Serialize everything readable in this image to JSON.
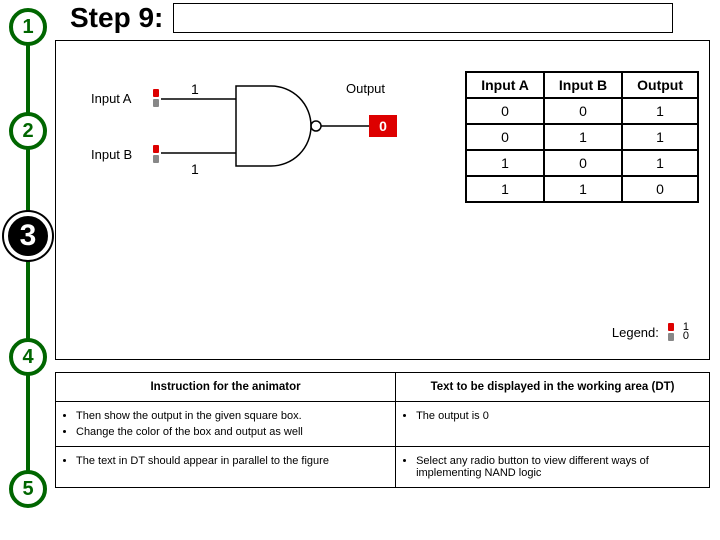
{
  "stepper": {
    "nodes": [
      "1",
      "2",
      "3",
      "4",
      "5"
    ],
    "active_index": 2
  },
  "header": {
    "title": "Step 9:"
  },
  "gate": {
    "inputA_label": "Input A",
    "inputB_label": "Input B",
    "inputA_value": "1",
    "inputB_value": "1",
    "output_label": "Output",
    "output_value": "0"
  },
  "truth_table": {
    "headers": [
      "Input A",
      "Input B",
      "Output"
    ],
    "rows": [
      [
        "0",
        "0",
        "1"
      ],
      [
        "0",
        "1",
        "1"
      ],
      [
        "1",
        "0",
        "1"
      ],
      [
        "1",
        "1",
        "0"
      ]
    ]
  },
  "legend": {
    "label": "Legend:",
    "top": "1",
    "bottom": "0"
  },
  "instructions": {
    "left_header": "Instruction for the animator",
    "right_header": "Text to be displayed in the working area (DT)",
    "left_items": [
      "Then show the output in the given square box.",
      "Change the color of the box and output as well",
      "The text in DT should appear  in parallel to the figure"
    ],
    "right_items_top": [
      "The output is 0"
    ],
    "right_items_bottom": [
      "Select any radio button to view different ways of implementing NAND logic"
    ]
  },
  "chart_data": {
    "type": "table",
    "title": "NAND truth table",
    "columns": [
      "Input A",
      "Input B",
      "Output"
    ],
    "rows": [
      [
        0,
        0,
        1
      ],
      [
        0,
        1,
        1
      ],
      [
        1,
        0,
        1
      ],
      [
        1,
        1,
        0
      ]
    ],
    "gate_inputs": {
      "A": 1,
      "B": 1
    },
    "gate_output": 0
  }
}
